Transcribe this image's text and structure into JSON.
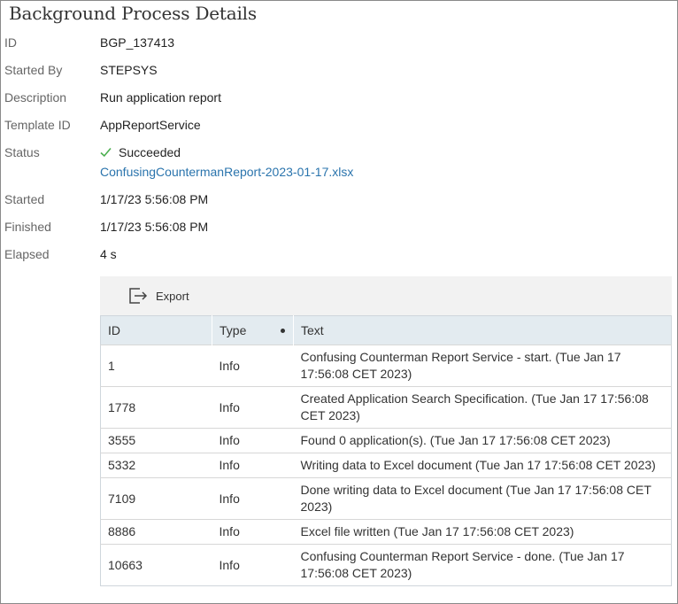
{
  "page": {
    "title": "Background Process Details"
  },
  "fields": {
    "id": {
      "label": "ID",
      "value": "BGP_137413"
    },
    "started_by": {
      "label": "Started By",
      "value": "STEPSYS"
    },
    "description": {
      "label": "Description",
      "value": "Run application report"
    },
    "template_id": {
      "label": "Template ID",
      "value": "AppReportService"
    },
    "status": {
      "label": "Status",
      "value": "Succeeded",
      "icon": "check-icon",
      "color": "#4caf50",
      "file_link": "ConfusingCountermanReport-2023-01-17.xlsx"
    },
    "started": {
      "label": "Started",
      "value": "1/17/23 5:56:08 PM"
    },
    "finished": {
      "label": "Finished",
      "value": "1/17/23 5:56:08 PM"
    },
    "elapsed": {
      "label": "Elapsed",
      "value": "4 s"
    }
  },
  "toolbar": {
    "export_label": "Export",
    "export_icon": "export-icon"
  },
  "table": {
    "columns": [
      "ID",
      "Type",
      "Text"
    ],
    "rows": [
      {
        "id": "1",
        "type": "Info",
        "text": "Confusing Counterman Report Service - start. (Tue Jan 17 17:56:08 CET 2023)"
      },
      {
        "id": "1778",
        "type": "Info",
        "text": "Created Application Search Specification. (Tue Jan 17 17:56:08 CET 2023)"
      },
      {
        "id": "3555",
        "type": "Info",
        "text": "Found 0 application(s). (Tue Jan 17 17:56:08 CET 2023)"
      },
      {
        "id": "5332",
        "type": "Info",
        "text": "Writing data to Excel document (Tue Jan 17 17:56:08 CET 2023)"
      },
      {
        "id": "7109",
        "type": "Info",
        "text": "Done writing data to Excel document (Tue Jan 17 17:56:08 CET 2023)"
      },
      {
        "id": "8886",
        "type": "Info",
        "text": "Excel file written (Tue Jan 17 17:56:08 CET 2023)"
      },
      {
        "id": "10663",
        "type": "Info",
        "text": "Confusing Counterman Report Service - done. (Tue Jan 17 17:56:08 CET 2023)"
      }
    ]
  }
}
